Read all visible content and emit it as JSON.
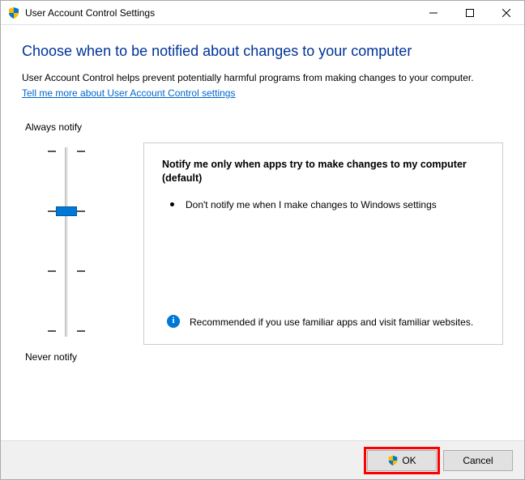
{
  "titlebar": {
    "title": "User Account Control Settings"
  },
  "heading": "Choose when to be notified about changes to your computer",
  "intro_text": "User Account Control helps prevent potentially harmful programs from making changes to your computer.",
  "link_text": "Tell me more about User Account Control settings",
  "slider": {
    "top_label": "Always notify",
    "bottom_label": "Never notify"
  },
  "description": {
    "title": "Notify me only when apps try to make changes to my computer (default)",
    "bullet": "Don't notify me when I make changes to Windows settings",
    "recommend": "Recommended if you use familiar apps and visit familiar websites."
  },
  "buttons": {
    "ok": "OK",
    "cancel": "Cancel"
  }
}
